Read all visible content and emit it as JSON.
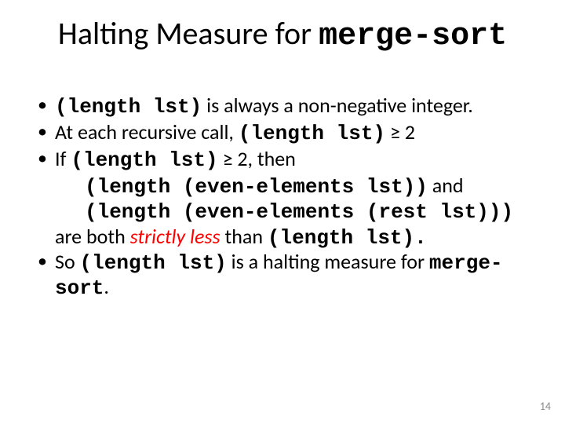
{
  "title": {
    "plain": "Halting Measure for ",
    "code": "merge-sort"
  },
  "bullets": {
    "b1_code": "(length lst)",
    "b1_tail": " is always  a non-negative integer.",
    "b2_head": "At each recursive call, ",
    "b2_code": "(length lst)",
    "b2_tail": " ≥ 2",
    "b3_head": "If ",
    "b3_code": "(length lst)",
    "b3_tail": " ≥ 2, then",
    "indent1": "(length (even-elements lst))",
    "indent1_tail": " and",
    "indent2": "(length (even-elements (rest lst)))",
    "after_indent_head": "are both  ",
    "after_indent_red": "strictly less",
    "after_indent_mid": " than ",
    "after_indent_code": "(length lst).",
    "b4_head": "So ",
    "b4_code": "(length lst)",
    "b4_mid": " is a halting measure for ",
    "b4_code2": "merge-sort",
    "b4_tail": "."
  },
  "page_number": "14"
}
